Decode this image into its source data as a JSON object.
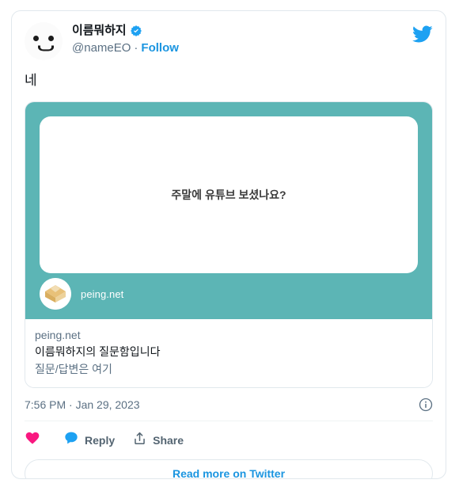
{
  "colors": {
    "twitter_blue": "#1DA1F2",
    "link_blue": "#1B95E0",
    "like_pink": "#F91880",
    "card_teal": "#5CB5B5",
    "border_gray": "#E1E8ED",
    "muted_text": "#5B7083",
    "primary_text": "#0F1419"
  },
  "header": {
    "avatar_name": "user-avatar",
    "display_name": "이름뭐하지",
    "verified": true,
    "handle": "@nameEO",
    "separator": "·",
    "follow_label": "Follow",
    "logo_label": "twitter-bird-logo"
  },
  "tweet": {
    "text": "네"
  },
  "link_preview": {
    "image": {
      "question_text": "주말에 유튜브 보셨나요?",
      "site_avatar_name": "peing-logo",
      "site_label": "peing.net"
    },
    "domain": "peing.net",
    "title": "이름뭐하지의 질문함입니다",
    "description": "질문/답변은 여기"
  },
  "meta": {
    "timestamp": "7:56 PM · Jan 29, 2023",
    "info_icon": "info-circle-icon"
  },
  "actions": [
    {
      "icon": "heart-icon",
      "label": ""
    },
    {
      "icon": "reply-bubble-icon",
      "label": "Reply"
    },
    {
      "icon": "share-icon",
      "label": "Share"
    }
  ],
  "footer": {
    "read_more_label": "Read more on Twitter"
  }
}
